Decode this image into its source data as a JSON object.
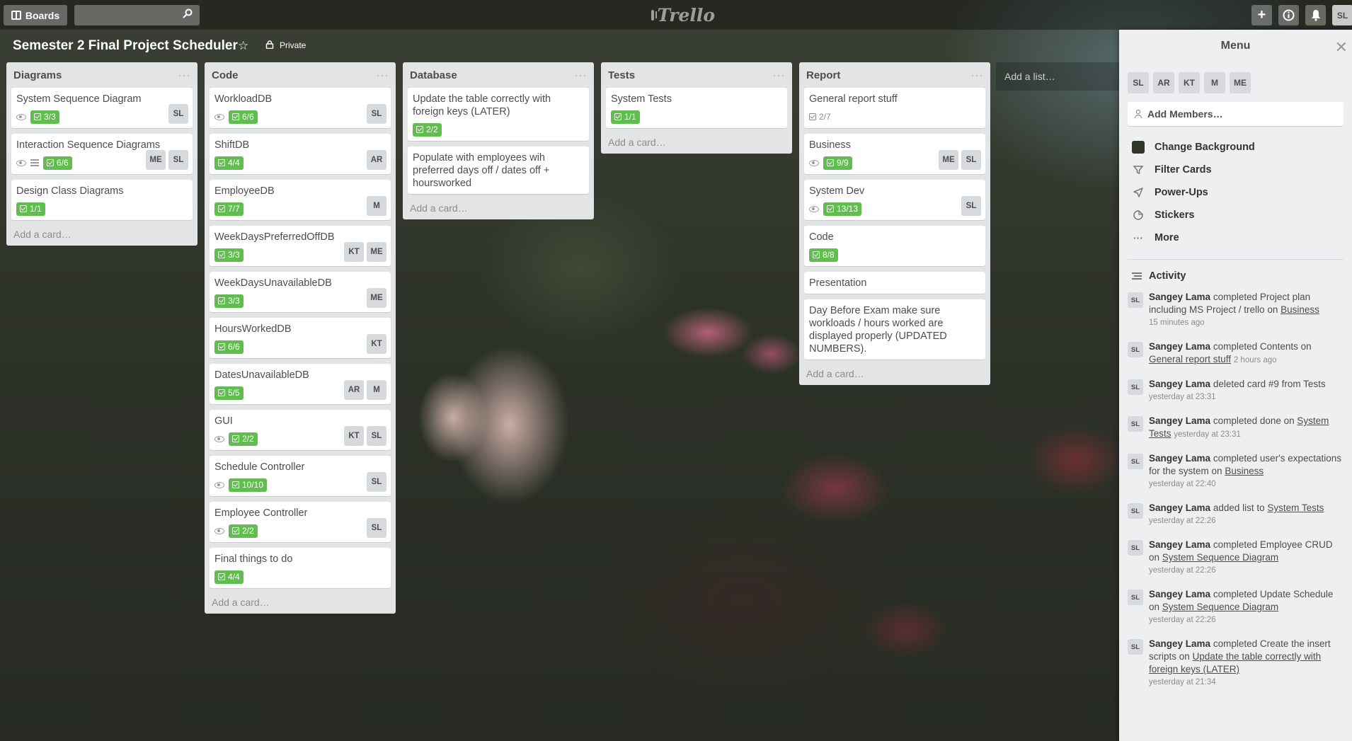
{
  "header": {
    "boards_label": "Boards",
    "search_value": "",
    "logo": "Trello",
    "user_initials": "SL"
  },
  "board": {
    "title": "Semester 2 Final Project Scheduler",
    "privacy": "Private"
  },
  "lists": [
    {
      "title": "Diagrams",
      "add_card": "Add a card…",
      "cards": [
        {
          "title": "System Sequence Diagram",
          "checklist": "3/3",
          "members": [
            "SL"
          ]
        },
        {
          "title": "Interaction Sequence Diagrams",
          "checklist": "6/6",
          "members": [
            "ME",
            "SL"
          ]
        },
        {
          "title": "Design Class Diagrams",
          "checklist": "1/1",
          "members": []
        }
      ]
    },
    {
      "title": "Code",
      "add_card": "Add a card…",
      "cards": [
        {
          "title": "WorkloadDB",
          "checklist": "6/6",
          "members": [
            "SL"
          ]
        },
        {
          "title": "ShiftDB",
          "checklist": "4/4",
          "members": [
            "AR"
          ]
        },
        {
          "title": "EmployeeDB",
          "checklist": "7/7",
          "members": [
            "M"
          ]
        },
        {
          "title": "WeekDaysPreferredOffDB",
          "checklist": "3/3",
          "members": [
            "KT",
            "ME"
          ]
        },
        {
          "title": "WeekDaysUnavailableDB",
          "checklist": "3/3",
          "members": [
            "ME"
          ]
        },
        {
          "title": "HoursWorkedDB",
          "checklist": "6/6",
          "members": [
            "KT"
          ]
        },
        {
          "title": "DatesUnavailableDB",
          "checklist": "5/5",
          "members": [
            "AR",
            "M"
          ]
        },
        {
          "title": "GUI",
          "checklist": "2/2",
          "members": [
            "KT",
            "SL"
          ]
        },
        {
          "title": "Schedule Controller",
          "checklist": "10/10",
          "members": [
            "SL"
          ]
        },
        {
          "title": "Employee Controller",
          "checklist": "2/2",
          "members": [
            "SL"
          ]
        },
        {
          "title": "Final things to do",
          "checklist": "4/4",
          "members": []
        }
      ]
    },
    {
      "title": "Database",
      "add_card": "Add a card…",
      "cards": [
        {
          "title": "Update the table correctly with foreign keys (LATER)",
          "checklist": "2/2"
        },
        {
          "title": "Populate with employees wih preferred days off / dates off + hoursworked"
        }
      ]
    },
    {
      "title": "Tests",
      "add_card": "Add a card…",
      "cards": [
        {
          "title": "System Tests",
          "checklist": "1/1"
        }
      ]
    },
    {
      "title": "Report",
      "add_card": "Add a card…",
      "cards": [
        {
          "title": "General report stuff",
          "checklist": "2/7"
        },
        {
          "title": "Business",
          "checklist": "9/9",
          "members": [
            "ME",
            "SL"
          ]
        },
        {
          "title": "System Dev",
          "checklist": "13/13",
          "members": [
            "SL"
          ]
        },
        {
          "title": "Code",
          "checklist": "8/8"
        },
        {
          "title": "Presentation"
        },
        {
          "title": "Day Before Exam make sure workloads / hours worked are displayed properly (UPDATED NUMBERS)."
        }
      ]
    }
  ],
  "add_list": "Add a list…",
  "sidebar": {
    "title": "Menu",
    "members": [
      "SL",
      "AR",
      "KT",
      "M",
      "ME"
    ],
    "add_members": "Add Members…",
    "items": [
      {
        "label": "Change Background",
        "icon": "background-swatch-icon"
      },
      {
        "label": "Filter Cards",
        "icon": "filter-icon"
      },
      {
        "label": "Power-Ups",
        "icon": "rocket-icon"
      },
      {
        "label": "Stickers",
        "icon": "sticker-icon"
      },
      {
        "label": "More",
        "icon": "more-icon"
      }
    ],
    "activity_title": "Activity",
    "activity": [
      {
        "avatar": "SL",
        "who": "Sangey Lama",
        "text": "completed Project plan including MS Project / trello on",
        "link": "Business",
        "time": "15 minutes ago"
      },
      {
        "avatar": "SL",
        "who": "Sangey Lama",
        "text": "completed Contents on",
        "link": "General report stuff",
        "time": "2 hours ago"
      },
      {
        "avatar": "SL",
        "who": "Sangey Lama",
        "text": "deleted card #9 from Tests",
        "link": "",
        "time": "yesterday at 23:31"
      },
      {
        "avatar": "SL",
        "who": "Sangey Lama",
        "text": "completed done on",
        "link": "System Tests",
        "time": "yesterday at 23:31"
      },
      {
        "avatar": "SL",
        "who": "Sangey Lama",
        "text": "completed user's expectations for the system on",
        "link": "Business",
        "time": "yesterday at 22:40"
      },
      {
        "avatar": "SL",
        "who": "Sangey Lama",
        "text": "added list to",
        "link": "System Tests",
        "time": "yesterday at 22:26"
      },
      {
        "avatar": "SL",
        "who": "Sangey Lama",
        "text": "completed Employee CRUD on",
        "link": "System Sequence Diagram",
        "time": "yesterday at 22:26"
      },
      {
        "avatar": "SL",
        "who": "Sangey Lama",
        "text": "completed Update Schedule on",
        "link": "System Sequence Diagram",
        "time": "yesterday at 22:26"
      },
      {
        "avatar": "SL",
        "who": "Sangey Lama",
        "text": "completed Create the insert scripts on",
        "link": "Update the table correctly with foreign keys (LATER)",
        "time": "yesterday at 21:34"
      }
    ]
  },
  "colors": {
    "checklist_complete": "#61bd4f",
    "list_bg": "#e2e4e6",
    "sidebar_bg": "#edeff0"
  }
}
